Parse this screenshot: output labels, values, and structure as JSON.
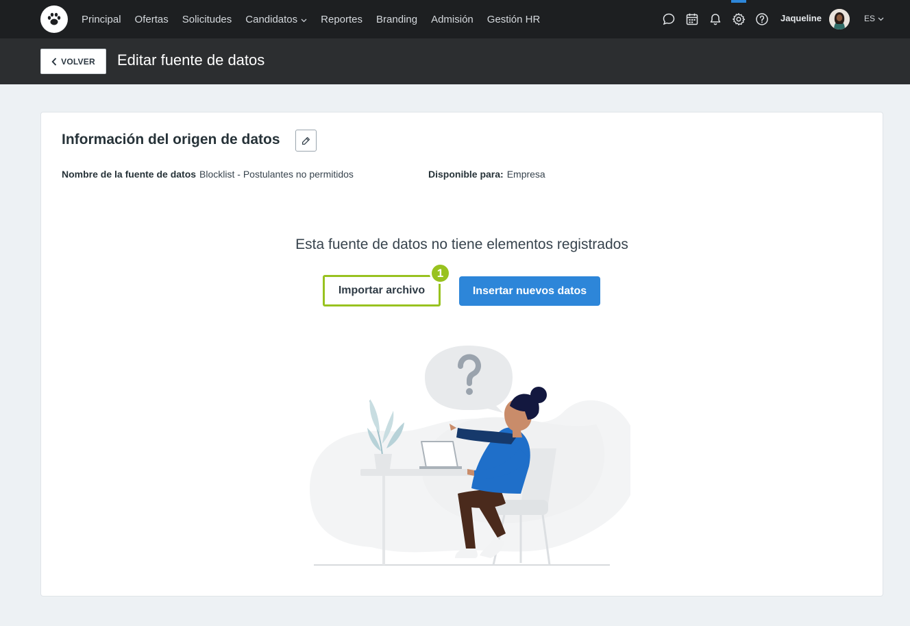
{
  "nav": {
    "items": [
      {
        "label": "Principal",
        "has_dropdown": false
      },
      {
        "label": "Ofertas",
        "has_dropdown": false
      },
      {
        "label": "Solicitudes",
        "has_dropdown": false
      },
      {
        "label": "Candidatos",
        "has_dropdown": true
      },
      {
        "label": "Reportes",
        "has_dropdown": false
      },
      {
        "label": "Branding",
        "has_dropdown": false
      },
      {
        "label": "Admisión",
        "has_dropdown": false
      },
      {
        "label": "Gestión HR",
        "has_dropdown": false
      }
    ],
    "icons": [
      "chat-icon",
      "calendar-icon",
      "bell-icon",
      "gear-icon",
      "help-icon"
    ],
    "active_icon": "gear-icon",
    "user_name": "Jaqueline",
    "language": "ES"
  },
  "subheader": {
    "back_label": "VOLVER",
    "title": "Editar fuente de datos"
  },
  "card": {
    "section_title": "Información del origen de datos",
    "fields": [
      {
        "label": "Nombre de la fuente de datos",
        "value": "Blocklist - Postulantes no permitidos"
      },
      {
        "label": "Disponible para:",
        "value": "Empresa"
      }
    ],
    "empty_message": "Esta fuente de datos no tiene elementos registrados",
    "import_label": "Importar archivo",
    "insert_label": "Insertar nuevos datos",
    "step_badge": "1"
  },
  "colors": {
    "nav_bg": "#1d1f21",
    "subheader_bg": "#2c2e30",
    "page_bg": "#edf1f4",
    "primary": "#2d86d9",
    "highlight": "#98c21f"
  }
}
